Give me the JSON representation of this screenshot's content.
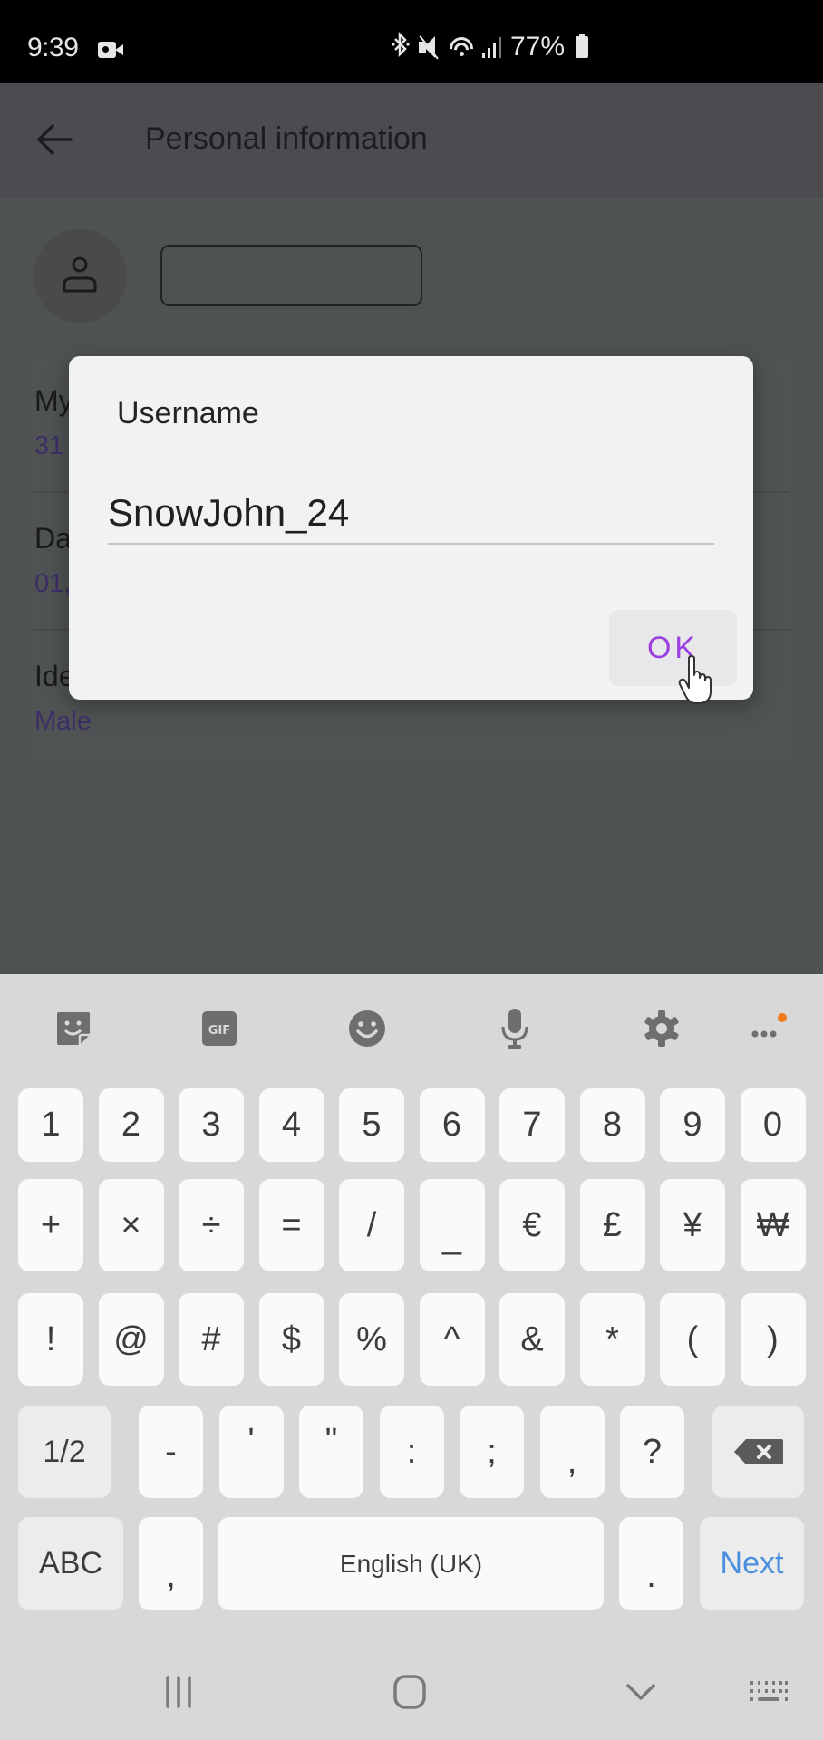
{
  "status_bar": {
    "time": "9:39",
    "battery_percent": "77%",
    "icons": [
      "screen-record-icon",
      "bluetooth-icon",
      "mute-icon",
      "wifi-icon",
      "signal-icon",
      "battery-icon"
    ]
  },
  "app_bar": {
    "title": "Personal information",
    "back_icon": "arrow-left-icon"
  },
  "profile": {
    "avatar_icon": "person-icon",
    "name_field_value": ""
  },
  "list": [
    {
      "label": "My",
      "value": "31"
    },
    {
      "label": "Da",
      "value": "01,"
    },
    {
      "label": "Ide",
      "value": "Male"
    }
  ],
  "dialog": {
    "title": "Username",
    "input_value": "SnowJohn_24",
    "ok_label": "OK",
    "accent_color": "#9b3fe0"
  },
  "keyboard": {
    "toolbar": [
      "sticker-icon",
      "gif-icon",
      "emoji-icon",
      "microphone-icon",
      "settings-icon",
      "more-icon"
    ],
    "gif_label": "GIF",
    "row1": [
      "1",
      "2",
      "3",
      "4",
      "5",
      "6",
      "7",
      "8",
      "9",
      "0"
    ],
    "row2": [
      "+",
      "×",
      "÷",
      "=",
      "/",
      "_",
      "€",
      "£",
      "¥",
      "₩"
    ],
    "row3": [
      "!",
      "@",
      "#",
      "$",
      "%",
      "^",
      "&",
      "*",
      "(",
      ")"
    ],
    "row4": {
      "page": "1/2",
      "keys": [
        "-",
        "'",
        "\"",
        ":",
        ";",
        ",",
        "?"
      ],
      "backspace": "backspace-icon"
    },
    "row5": {
      "abc": "ABC",
      "comma": ",",
      "space": "English (UK)",
      "period": ".",
      "action": "Next"
    },
    "action_color": "#4a8fdf"
  },
  "nav_bar": {
    "buttons": [
      "recent-apps-icon",
      "home-icon",
      "hide-keyboard-icon",
      "keyboard-switch-icon"
    ]
  }
}
